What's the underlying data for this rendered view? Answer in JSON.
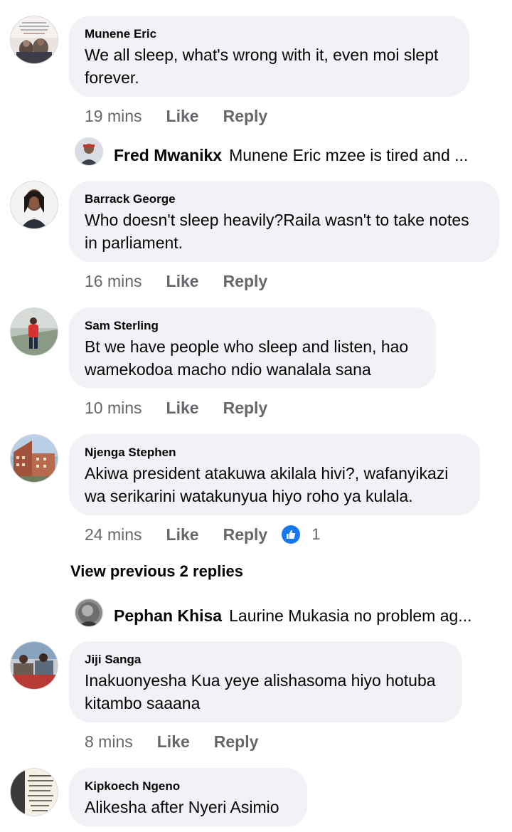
{
  "comments": [
    {
      "author": "Munene Eric",
      "text": "We all sleep, what's wrong with it, even moi slept forever.",
      "time": "19 mins",
      "like": "Like",
      "reply": "Reply"
    },
    {
      "author": "Barrack George",
      "text": "Who doesn't sleep heavily?Raila wasn't to take notes in parliament.",
      "time": "16 mins",
      "like": "Like",
      "reply": "Reply"
    },
    {
      "author": "Sam Sterling",
      "text": "Bt we have people who sleep and listen, hao wamekodoa macho ndio wanalala sana",
      "time": "10 mins",
      "like": "Like",
      "reply": "Reply"
    },
    {
      "author": "Njenga Stephen",
      "text": "Akiwa president atakuwa akilala hivi?, wafanyikazi wa serikarini watakunyua hiyo roho ya kulala.",
      "time": "24 mins",
      "like": "Like",
      "reply": "Reply",
      "reaction_count": "1"
    },
    {
      "author": "Jiji Sanga",
      "text": "Inakuonyesha Kua yeye alishasoma hiyo hotuba kitambo saaana",
      "time": "8 mins",
      "like": "Like",
      "reply": "Reply"
    },
    {
      "author": "Kipkoech Ngeno",
      "text": "Alikesha after Nyeri Asimio"
    }
  ],
  "reply_previews": [
    {
      "author": "Fred Mwanikx",
      "text": "Munene Eric mzee is tired and ..."
    },
    {
      "author": "Pephan Khisa",
      "text": "Laurine Mukasia no problem ag..."
    }
  ],
  "view_previous": "View previous 2 replies",
  "avatar_texts": {
    "munene": "... are we tired of ... sitting the wrong people",
    "kipkoech": "Never let anything that has happened in your life. It cannot be changed, undone or forgotten, so take it as a lesson and move"
  },
  "colors": {
    "bubble": "#f0f2f5",
    "meta_text": "#65676b",
    "like_blue": "#1877f2"
  }
}
